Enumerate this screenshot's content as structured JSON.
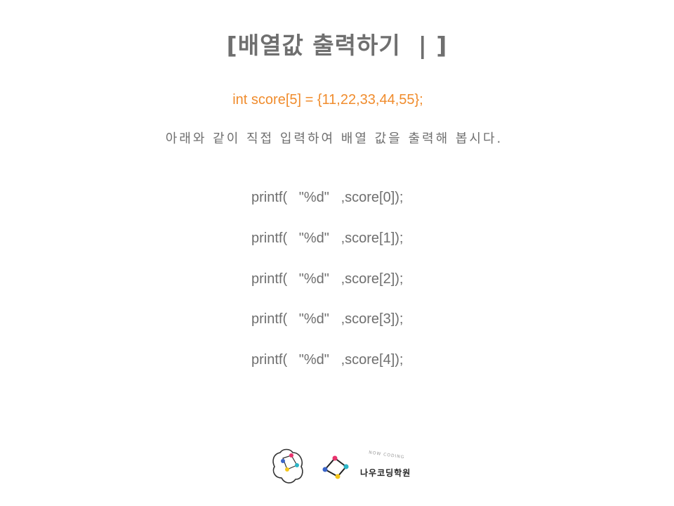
{
  "title": "[배열값 출력하기  | ]",
  "code_line": "int score[5] = {11,22,33,44,55};",
  "instruction": "아래와 같이 직접 입력하여 배열 값을 출력해 봅시다.",
  "printf_lines": [
    "printf(   \"%d\"   ,score[0]);",
    "printf(   \"%d\"   ,score[1]);",
    "printf(   \"%d\"   ,score[2]);",
    "printf(   \"%d\"   ,score[3]);",
    "printf(   \"%d\"   ,score[4]);"
  ],
  "logo": {
    "brand_name": "나우코딩학원",
    "brand_sub": "NOW CODING",
    "colors": [
      "#e8336d",
      "#2bb5c7",
      "#f5c61a",
      "#3a64c8"
    ]
  }
}
